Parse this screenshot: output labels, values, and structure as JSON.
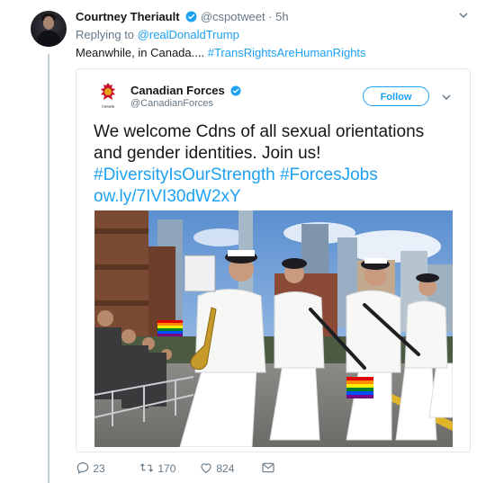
{
  "tweet": {
    "author_name": "Courtney Theriault",
    "author_handle": "@cspotweet",
    "separator": "·",
    "time": "5h",
    "reply_prefix": "Replying to",
    "reply_to": "@realDonaldTrump",
    "text": "Meanwhile, in Canada....",
    "hashtag": "#TransRightsAreHumanRights"
  },
  "quoted": {
    "name": "Canadian Forces",
    "handle": "@CanadianForces",
    "follow_label": "Follow",
    "line1": "We welcome Cdns of all sexual orientations",
    "line2": "and gender identities. Join us!",
    "hashtags": "#DiversityIsOurStrength #ForcesJobs",
    "link": "ow.ly/7IVI30dW2xY",
    "logo_text": "Canada"
  },
  "actions": {
    "replies": "23",
    "retweets": "170",
    "likes": "824"
  },
  "colors": {
    "accent": "#1da1f2",
    "muted": "#657786",
    "border": "#e1e8ed"
  },
  "icons": [
    "verified-icon",
    "chevron-down-icon",
    "reply-icon",
    "retweet-icon",
    "like-icon",
    "message-icon"
  ]
}
